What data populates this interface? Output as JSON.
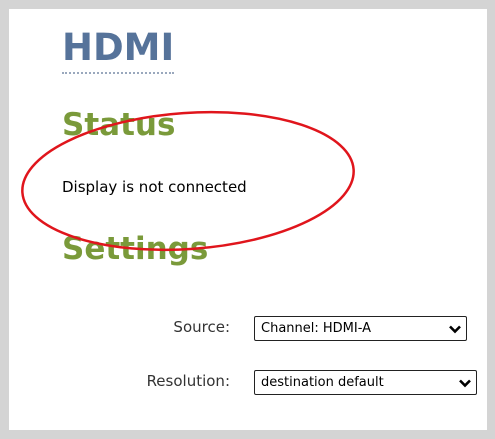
{
  "page": {
    "title": "HDMI"
  },
  "status": {
    "heading": "Status",
    "message": "Display is not connected"
  },
  "settings": {
    "heading": "Settings",
    "source": {
      "label": "Source:",
      "value": "Channel: HDMI-A"
    },
    "resolution": {
      "label": "Resolution:",
      "value": "destination default"
    }
  },
  "colors": {
    "title": "#56739a",
    "heading": "#7a9a3a",
    "annotation": "#e0151c",
    "frame": "#d4d4d4"
  },
  "icons": {
    "dropdown": "chevron-down-icon",
    "annotation": "red-ellipse-highlight"
  }
}
